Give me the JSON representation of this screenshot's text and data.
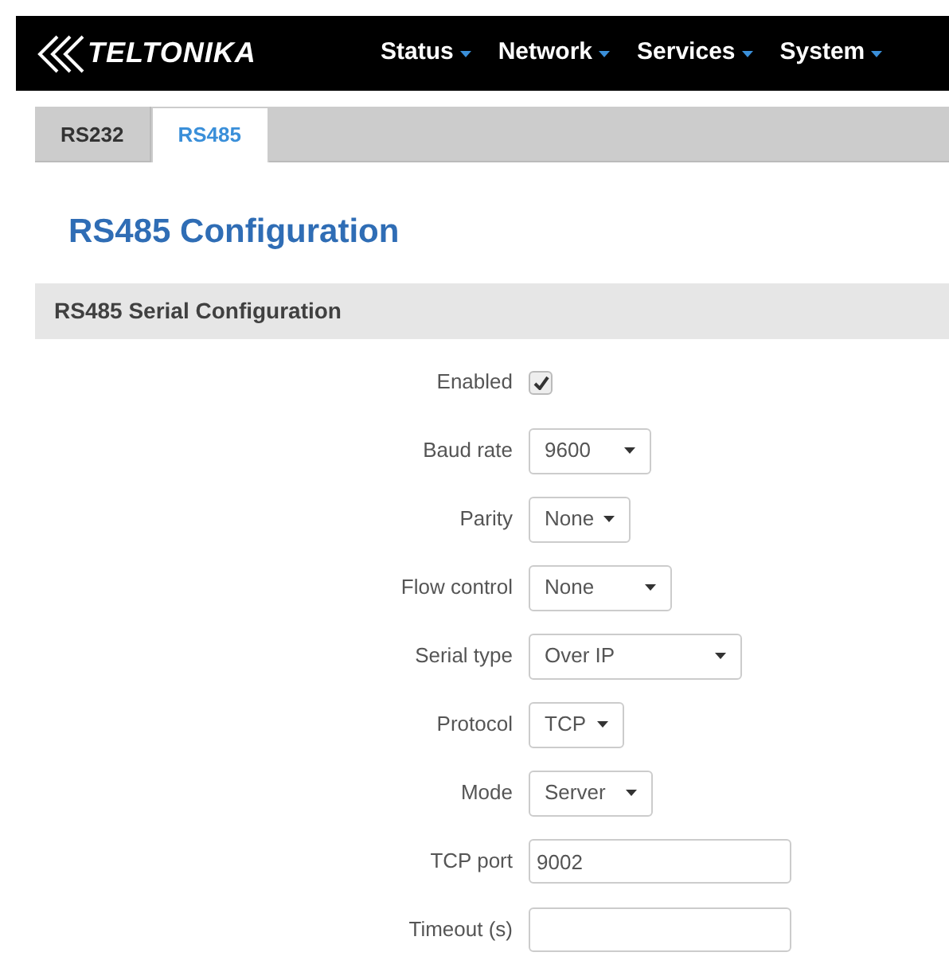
{
  "header": {
    "logo": "TELTONIKA",
    "menu": [
      {
        "label": "Status"
      },
      {
        "label": "Network"
      },
      {
        "label": "Services"
      },
      {
        "label": "System"
      }
    ]
  },
  "tabs": [
    {
      "label": "RS232",
      "selected": false
    },
    {
      "label": "RS485",
      "selected": true
    }
  ],
  "title": "RS485 Configuration",
  "section": {
    "title": "RS485 Serial Configuration",
    "fields": [
      {
        "kind": "checkbox",
        "label": "Enabled",
        "checked": true
      },
      {
        "kind": "select",
        "label": "Baud rate",
        "value": "9600"
      },
      {
        "kind": "select",
        "label": "Parity",
        "value": "None"
      },
      {
        "kind": "select",
        "label": "Flow control",
        "value": "None"
      },
      {
        "kind": "select",
        "label": "Serial type",
        "value": "Over IP"
      },
      {
        "kind": "select",
        "label": "Protocol",
        "value": "TCP"
      },
      {
        "kind": "select",
        "label": "Mode",
        "value": "Server"
      },
      {
        "kind": "text",
        "label": "TCP port",
        "value": "9002"
      },
      {
        "kind": "text",
        "label": "Timeout (s)"
      }
    ]
  }
}
